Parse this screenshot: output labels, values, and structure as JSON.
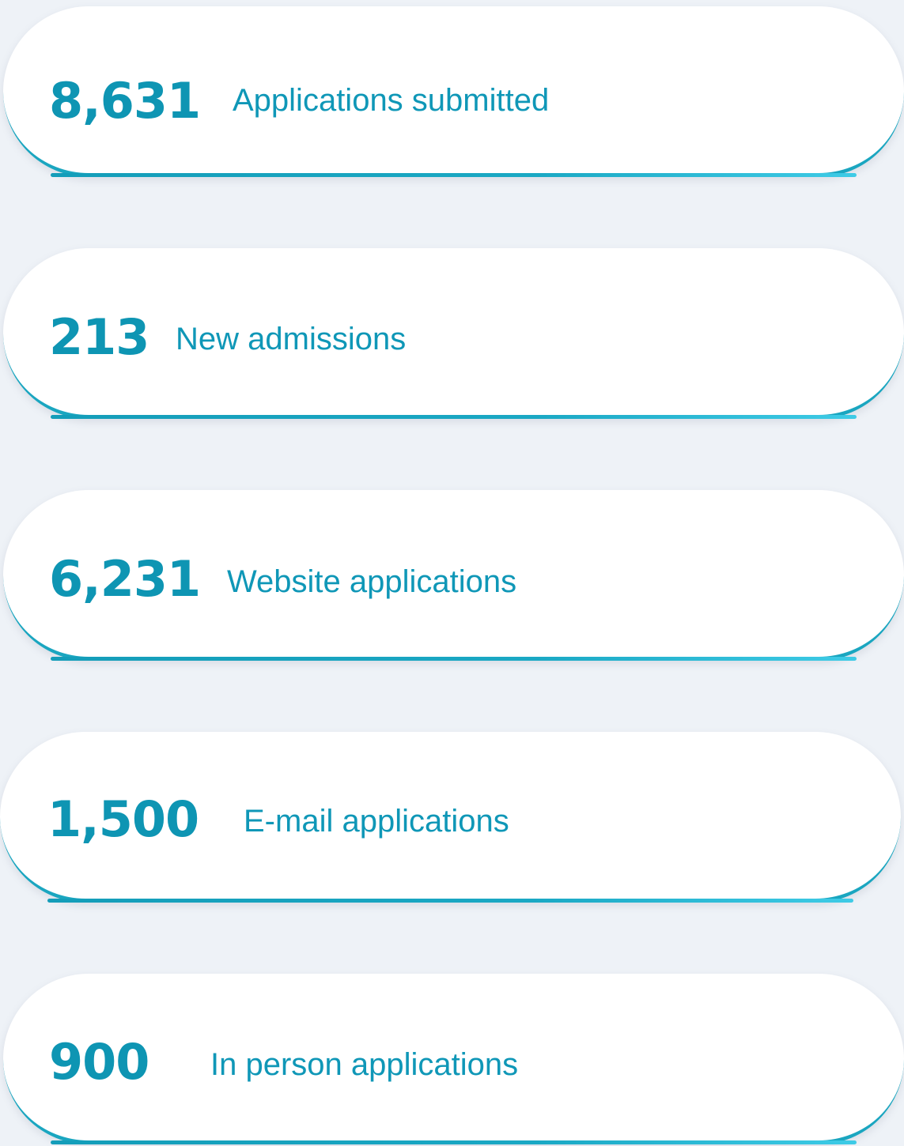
{
  "stats": [
    {
      "value": "8,631",
      "label": "Applications submitted"
    },
    {
      "value": "213",
      "label": "New admissions"
    },
    {
      "value": "6,231",
      "label": "Website applications"
    },
    {
      "value": "1,500",
      "label": "E-mail applications"
    },
    {
      "value": "900",
      "label": "In person applications"
    }
  ],
  "colors": {
    "background": "#eef2f7",
    "card": "#ffffff",
    "accent": "#0e95b3",
    "accent_light": "#3ecbe6"
  }
}
